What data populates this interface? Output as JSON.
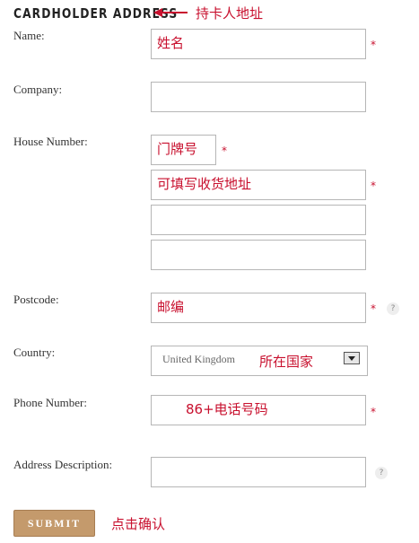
{
  "heading": "CARDHOLDER ADDRESS",
  "annotations": {
    "heading_note": "持卡人地址",
    "country_note": "所在国家",
    "submit_note": "点击确认"
  },
  "fields": {
    "name": {
      "label": "Name:",
      "value": "姓名",
      "required": "*"
    },
    "company": {
      "label": "Company:",
      "value": ""
    },
    "house_number": {
      "label": "House Number:",
      "value": "门牌号",
      "required": "*"
    },
    "address_line1": {
      "value": "可填写收货地址",
      "required": "*"
    },
    "address_line2": {
      "value": ""
    },
    "address_line3": {
      "value": ""
    },
    "postcode": {
      "label": "Postcode:",
      "value": "邮编",
      "required": "*",
      "help": "?"
    },
    "country": {
      "label": "Country:",
      "value": "United Kingdom"
    },
    "phone": {
      "label": "Phone Number:",
      "value": "86+电话号码",
      "required": "*"
    },
    "address_description": {
      "label": "Address Description:",
      "value": "",
      "help": "?"
    }
  },
  "submit_label": "SUBMIT",
  "colors": {
    "annotation": "#c8102e",
    "submit_bg": "#c49a6c",
    "border": "#b6b6b6"
  }
}
